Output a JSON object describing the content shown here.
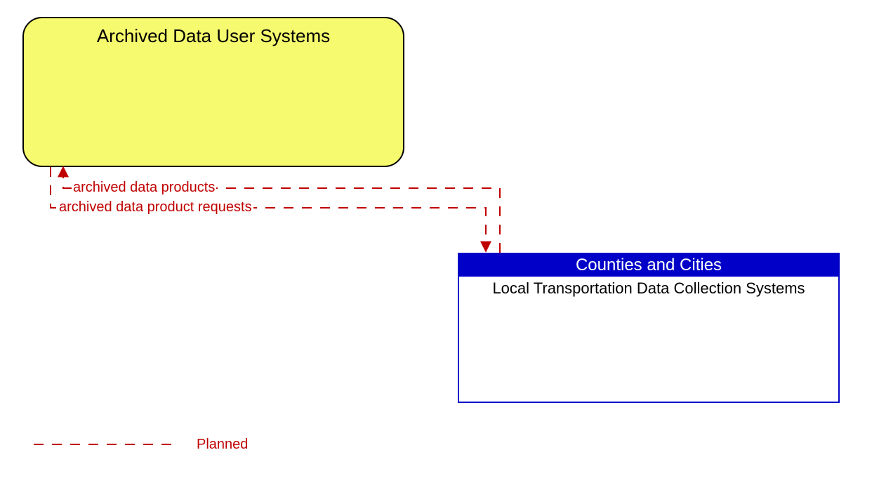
{
  "nodes": {
    "archived_data_user_systems": {
      "title": "Archived Data User Systems"
    },
    "local_transport": {
      "header": "Counties and Cities",
      "body": "Local Transportation Data Collection Systems"
    }
  },
  "flows": {
    "to_yellow": "archived data products",
    "to_box": "archived data product requests"
  },
  "legend": {
    "planned": "Planned"
  },
  "colors": {
    "planned_line": "#c00000",
    "box_border": "#0000c8",
    "yellow_fill": "#f6fa6e"
  }
}
